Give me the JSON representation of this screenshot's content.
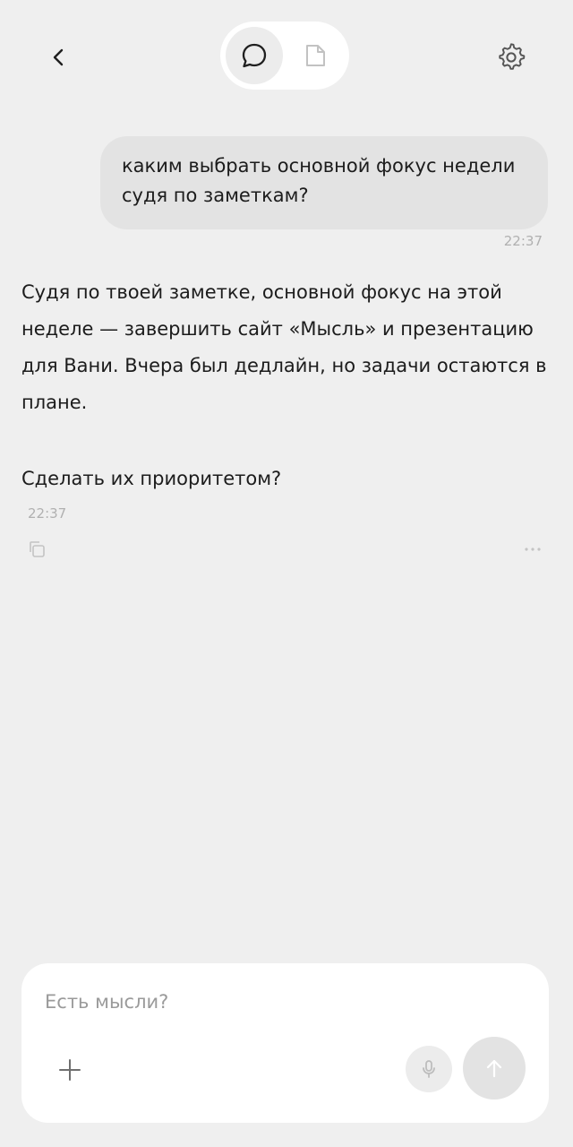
{
  "header": {
    "back_icon": "chevron-left-icon",
    "mode_toggle": {
      "items": [
        {
          "icon": "chat-bubble-icon",
          "selected": true
        },
        {
          "icon": "note-icon",
          "selected": false
        }
      ]
    },
    "settings_icon": "gear-icon"
  },
  "conversation": {
    "user_message": {
      "text": "каким выбрать основной фокус недели судя по заметкам?",
      "time": "22:37"
    },
    "assistant_message": {
      "text": "Судя по твоей заметке, основной фокус на этой неделе — завершить сайт «Мысль» и презентацию для Вани. Вчера был дедлайн, но задачи остаются в плане.",
      "question": "Сделать их приоритетом?",
      "time": "22:37",
      "actions": {
        "copy_icon": "copy-icon",
        "more_icon": "more-icon"
      }
    }
  },
  "composer": {
    "placeholder": "Есть мысли?",
    "value": "",
    "add_icon": "plus-icon",
    "mic_icon": "microphone-icon",
    "send_icon": "arrow-up-icon"
  },
  "colors": {
    "background": "#efefef",
    "user_bubble": "#e3e3e3",
    "surface": "#ffffff",
    "muted_text": "#b0b0b0",
    "icon": "#1f1f1f",
    "icon_muted": "#c2c2c2"
  }
}
